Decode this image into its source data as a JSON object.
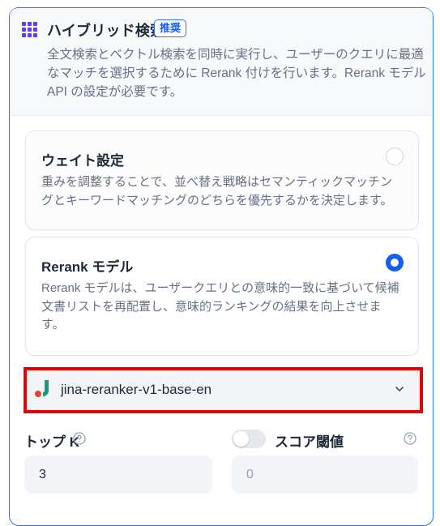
{
  "hybrid": {
    "title": "ハイブリッド検索",
    "badge": "推奨",
    "description": "全文検索とベクトル検索を同時に実行し、ユーザーのクエリに最適なマッチを選択するために Rerank 付けを行います。Rerank モデル API の設定が必要です。"
  },
  "options": [
    {
      "title": "ウェイト設定",
      "description": "重みを調整することで、並べ替え戦略はセマンティックマッチングとキーワードマッチングのどちらを優先するかを決定します。",
      "selected": false
    },
    {
      "title": "Rerank モデル",
      "description": "Rerank モデルは、ユーザークエリとの意味的一致に基づいて候補文書リストを再配置し、意味的ランキングの結果を向上させます。",
      "selected": true
    }
  ],
  "model_select": {
    "value": "jina-reranker-v1-base-en",
    "logo_icon": "jina-logo-icon",
    "chevron_icon": "chevron-down-icon"
  },
  "top_k": {
    "label": "トップ K",
    "value": "3"
  },
  "score_threshold": {
    "label": "スコア閾値",
    "enabled": false,
    "placeholder": "0"
  },
  "colors": {
    "accent": "#155eef",
    "border_accent": "#2f6ff0",
    "highlight": "#e60000",
    "grid_icon": "#6938ef"
  }
}
